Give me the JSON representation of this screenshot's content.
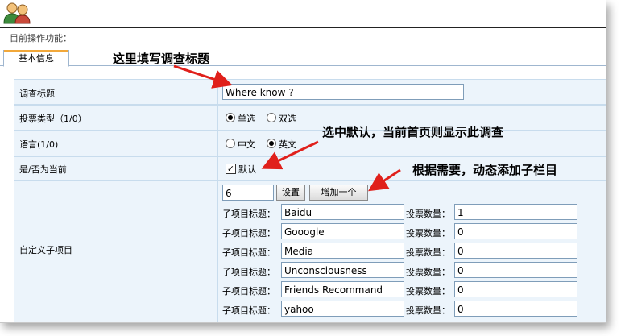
{
  "breadcrumb": "目前操作功能：",
  "tabs": [
    {
      "label": "基本信息"
    }
  ],
  "annotations": {
    "title_hint": "这里填写调查标题",
    "default_hint": "选中默认，当前首页则显示此调查",
    "children_hint": "根据需要，动态添加子栏目"
  },
  "form": {
    "title_label": "调查标题",
    "title_value": "Where know ?",
    "vote_type_label": "投票类型（1/0）",
    "vote_type_options": [
      "单选",
      "双选"
    ],
    "vote_type_selected": "单选",
    "language_label": "语言(1/0)",
    "language_options": [
      "中文",
      "英文"
    ],
    "language_selected": "英文",
    "current_label": "是/否为当前",
    "default_checkbox_label": "默认",
    "default_checked": true,
    "custom_items_label": "自定义子项目",
    "count_value": "6",
    "set_button": "设置",
    "add_button": "增加一个",
    "item_title_label": "子项目标题：",
    "vote_count_label": "投票数量：",
    "items": [
      {
        "title": "Baidu",
        "votes": "1"
      },
      {
        "title": "Gooogle",
        "votes": "0"
      },
      {
        "title": "Media",
        "votes": "0"
      },
      {
        "title": "Unconsciousness",
        "votes": "0"
      },
      {
        "title": "Friends Recommand",
        "votes": "0"
      },
      {
        "title": "yahoo",
        "votes": "0"
      }
    ]
  },
  "colors": {
    "accent_red": "#e0201b",
    "row_bg": "#ecf4fb",
    "grid": "#c8dced",
    "tab_accent": "#f2a83a"
  }
}
